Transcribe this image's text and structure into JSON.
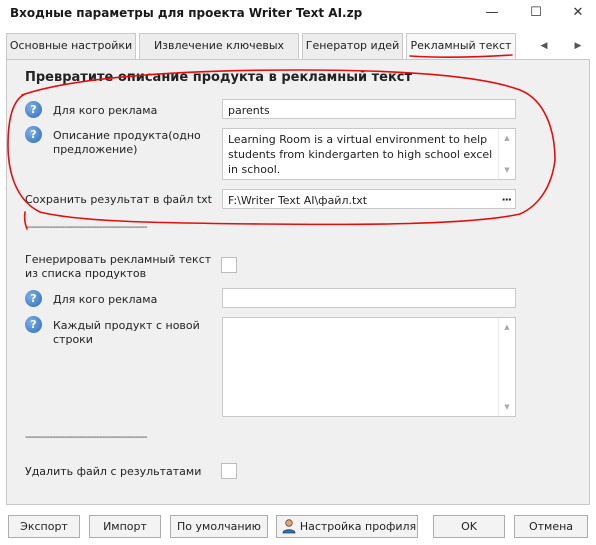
{
  "window": {
    "title": "Входные параметры для проекта Writer Text AI.zp",
    "minimize_glyph": "—",
    "maximize_glyph": "☐",
    "close_glyph": "✕"
  },
  "tabs": [
    {
      "label": "Основные настройки",
      "active": false
    },
    {
      "label": "Извлечение ключевых слов",
      "active": false
    },
    {
      "label": "Генератор идей",
      "active": false
    },
    {
      "label": "Рекламный текст",
      "active": true
    }
  ],
  "tab_nav": {
    "prev": "◀",
    "next": "▶"
  },
  "section": {
    "title": "Превратите описание продукта в рекламный текст",
    "audience_label": "Для кого реклама",
    "audience_value": "parents",
    "description_label": "Описание продукта(одно предложение)",
    "description_value": "Learning Room is a virtual environment to help students from kindergarten to high school excel in school.",
    "save_label": "Сохранить результат в файл txt",
    "save_value": "F:\\Writer Text AI\\файл.txt",
    "browse_glyph": "···",
    "separator": "-----------------------------------------"
  },
  "batch": {
    "generate_label": "Генерировать рекламный текст из списка продуктов",
    "generate_checked": false,
    "audience_label": "Для кого реклама",
    "audience_value": "",
    "products_label": "Каждый продукт с новой строки",
    "products_value": "",
    "separator": "-----------------------------------------",
    "delete_label": "Удалить файл с результатами",
    "delete_checked": false
  },
  "help_glyph": "?",
  "scroll": {
    "up": "▲",
    "down": "▼"
  },
  "buttons": {
    "export": "Экспорт",
    "import": "Импорт",
    "default": "По умолчанию",
    "profile": "Настройка профиля",
    "ok": "OK",
    "cancel": "Отмена"
  },
  "colors": {
    "annotation": "#e01010",
    "tab_underline": "#e01010",
    "help_icon": "#2e6bb8"
  }
}
